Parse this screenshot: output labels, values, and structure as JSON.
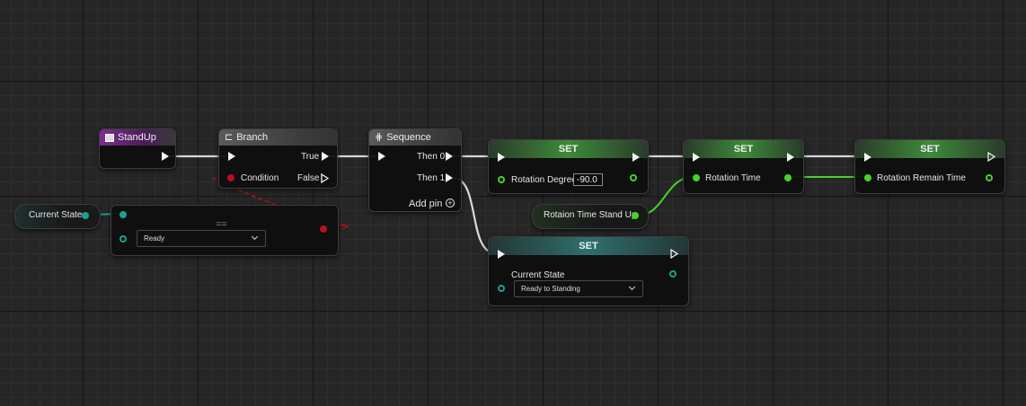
{
  "nodes": {
    "standup": {
      "title": "StandUp",
      "icon": "event-icon",
      "color": "#7a2f8c"
    },
    "branch": {
      "title": "Branch",
      "icon": "branch-icon",
      "condition_label": "Condition",
      "true_label": "True",
      "false_label": "False"
    },
    "sequence": {
      "title": "Sequence",
      "icon": "sequence-icon",
      "then0_label": "Then 0",
      "then1_label": "Then 1",
      "add_pin_label": "Add pin"
    },
    "equals": {
      "title": "==",
      "dropdown_value": "Ready"
    },
    "set_rotation_degree": {
      "title": "SET",
      "label": "Rotation Degree",
      "value": "-90.0"
    },
    "set_rotation_time": {
      "title": "SET",
      "label": "Rotation Time"
    },
    "set_rotation_remain": {
      "title": "SET",
      "label": "Rotation Remain Time"
    },
    "set_current_state": {
      "title": "SET",
      "label": "Current State",
      "dropdown_value": "Ready to Standing"
    }
  },
  "variables": {
    "current_state": "Current State",
    "rotation_time_standup": "Rotaion Time Stand Up"
  },
  "colors": {
    "exec": "#f2f2f2",
    "float": "#44d42a",
    "enum": "#1aa196",
    "bool": "#b8101e",
    "event": "#7a2f8c"
  }
}
